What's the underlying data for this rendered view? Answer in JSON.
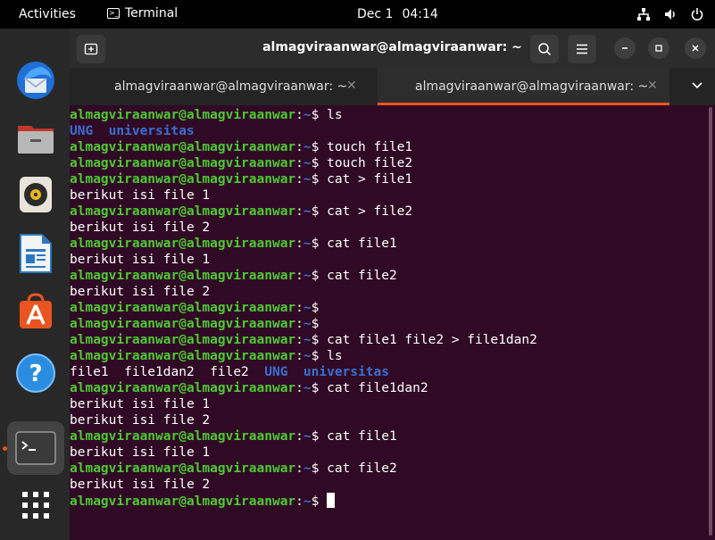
{
  "topbar": {
    "activities": "Activities",
    "app_name": "Terminal",
    "date": "Dec 1",
    "time": "04:14"
  },
  "dock": {
    "items": [
      {
        "name": "thunderbird-icon"
      },
      {
        "name": "files-icon"
      },
      {
        "name": "rhythmbox-icon"
      },
      {
        "name": "libreoffice-writer-icon"
      },
      {
        "name": "app-center-icon"
      },
      {
        "name": "help-icon"
      },
      {
        "name": "terminal-icon"
      },
      {
        "name": "show-apps-icon"
      }
    ]
  },
  "window": {
    "title": "almagviraanwar@almagviraanwar: ~",
    "tabs": [
      {
        "label": "almagviraanwar@almagviraanwar: ~"
      },
      {
        "label": "almagviraanwar@almagviraanwar: ~"
      }
    ]
  },
  "terminal": {
    "prompt_user": "almagviraanwar@almagviraanwar",
    "prompt_path": "~",
    "lines": [
      {
        "type": "cmd",
        "text": "ls"
      },
      {
        "type": "dirs",
        "text": "UNG  universitas"
      },
      {
        "type": "cmd",
        "text": "touch file1"
      },
      {
        "type": "cmd",
        "text": "touch file2"
      },
      {
        "type": "cmd",
        "text": "cat > file1"
      },
      {
        "type": "out",
        "text": "berikut isi file 1"
      },
      {
        "type": "cmd",
        "text": "cat > file2"
      },
      {
        "type": "out",
        "text": "berikut isi file 2"
      },
      {
        "type": "cmd",
        "text": "cat file1"
      },
      {
        "type": "out",
        "text": "berikut isi file 1"
      },
      {
        "type": "cmd",
        "text": "cat file2"
      },
      {
        "type": "out",
        "text": "berikut isi file 2"
      },
      {
        "type": "cmd",
        "text": ""
      },
      {
        "type": "cmd",
        "text": ""
      },
      {
        "type": "cmd",
        "text": "cat file1 file2 > file1dan2"
      },
      {
        "type": "cmd",
        "text": "ls"
      },
      {
        "type": "mixed",
        "plain": "file1  file1dan2  file2  ",
        "dirs": "UNG  universitas"
      },
      {
        "type": "cmd",
        "text": "cat file1dan2"
      },
      {
        "type": "out",
        "text": "berikut isi file 1"
      },
      {
        "type": "out",
        "text": "berikut isi file 2"
      },
      {
        "type": "cmd",
        "text": "cat file1"
      },
      {
        "type": "out",
        "text": "berikut isi file 1"
      },
      {
        "type": "cmd",
        "text": "cat file2"
      },
      {
        "type": "out",
        "text": "berikut isi file 2"
      },
      {
        "type": "cursor",
        "text": ""
      }
    ]
  }
}
